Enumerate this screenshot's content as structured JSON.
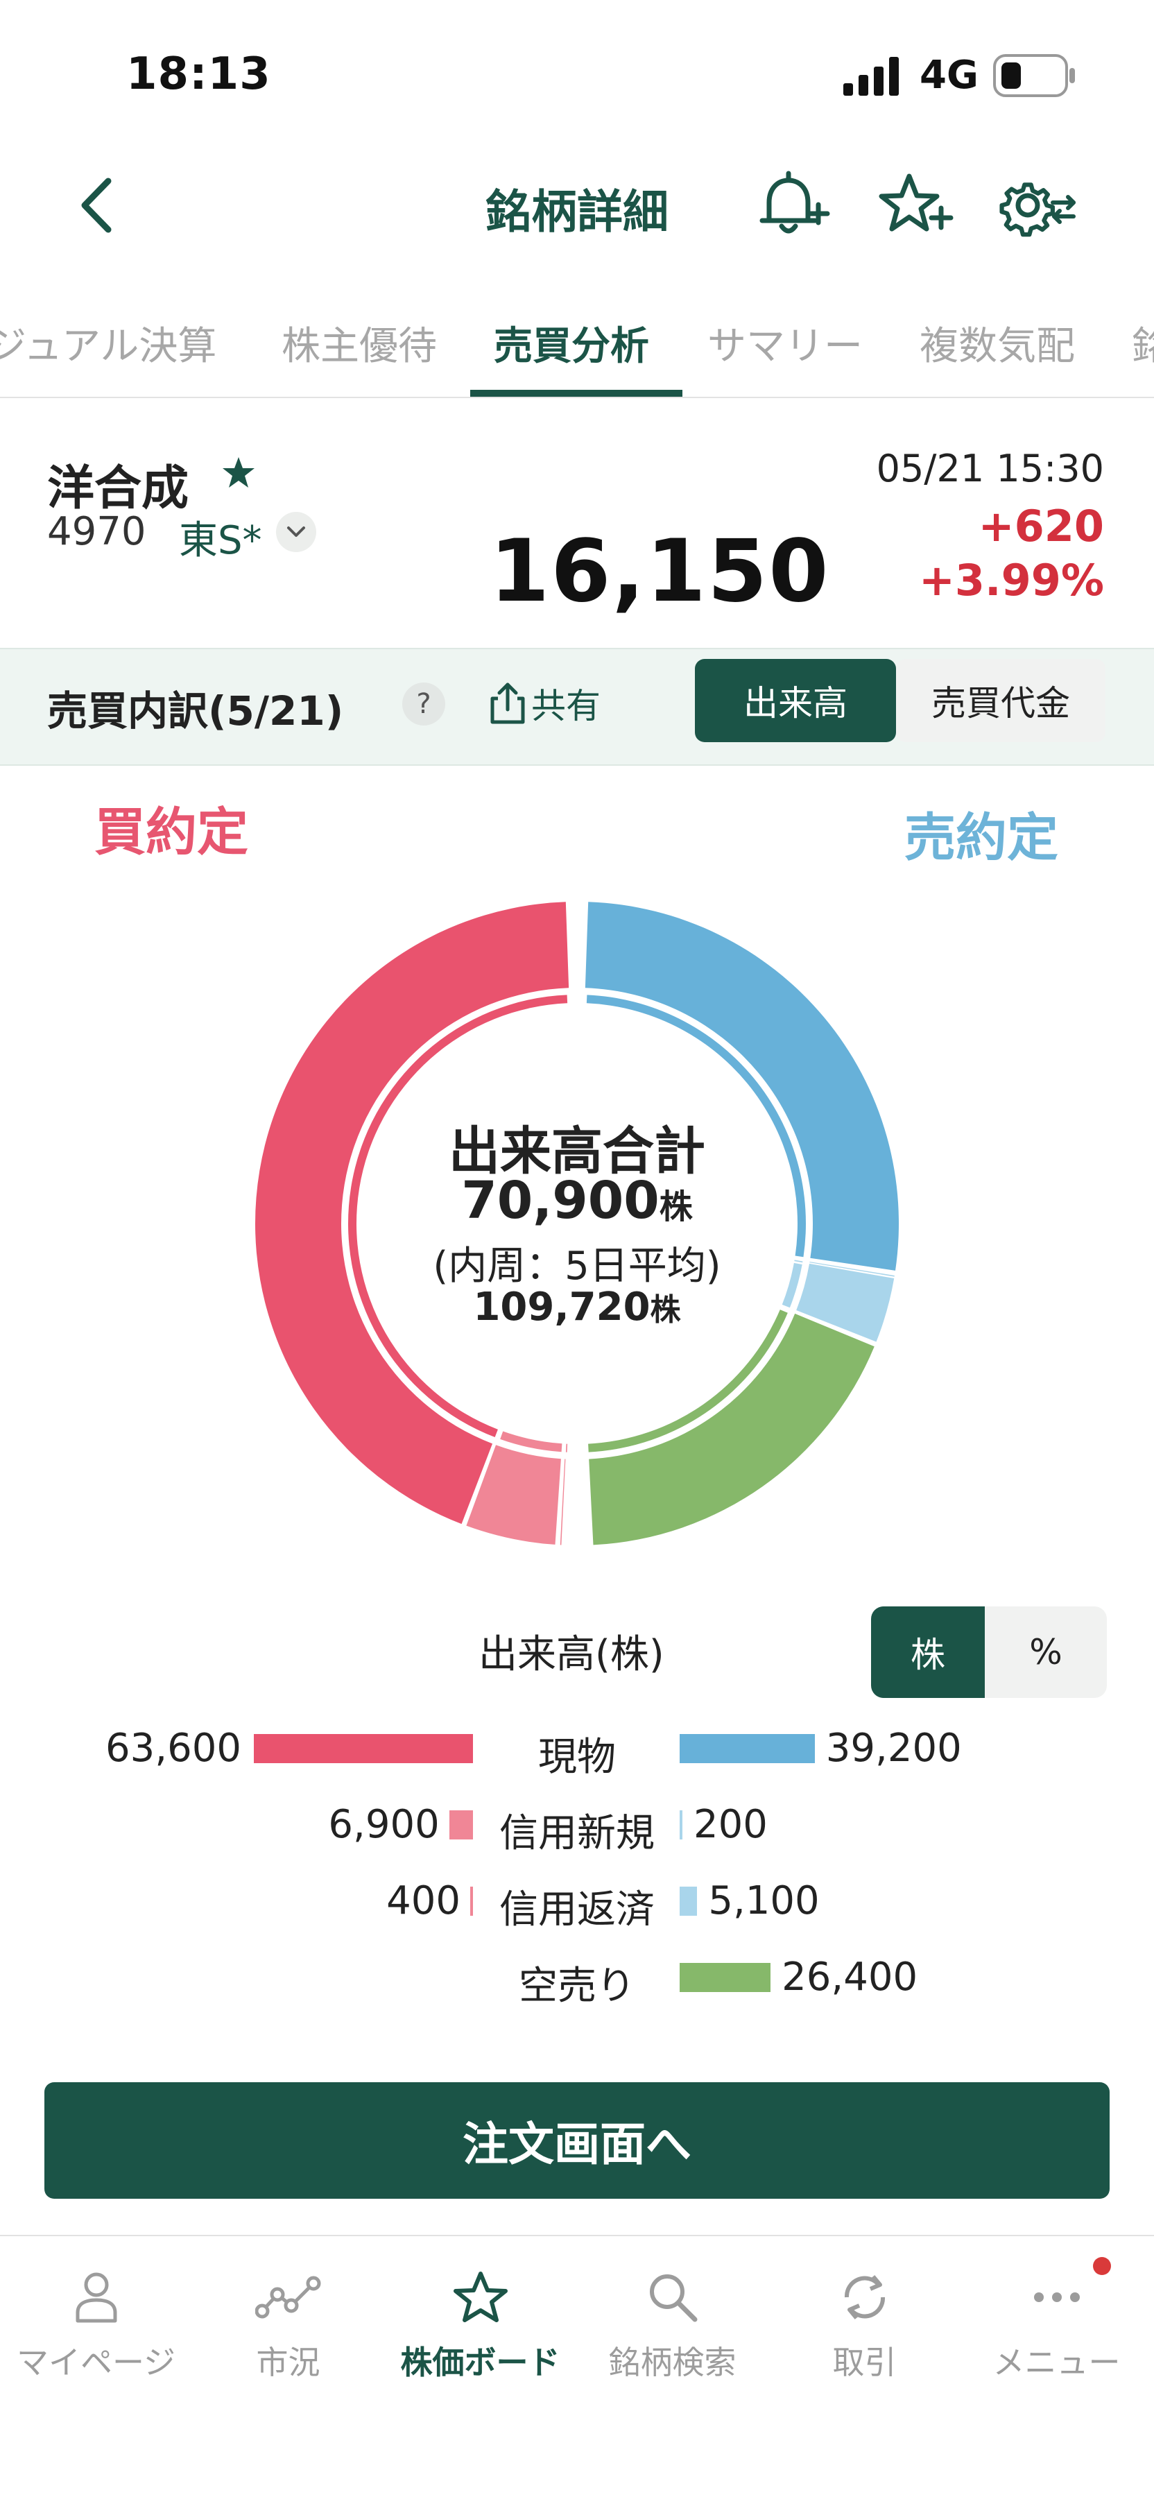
{
  "status": {
    "time": "18:13",
    "network": "4G"
  },
  "header": {
    "title": "銘柄詳細"
  },
  "tabs": [
    {
      "label": "ジュアル決算"
    },
    {
      "label": "株主優待"
    },
    {
      "label": "売買分析"
    },
    {
      "label": "サマリー"
    },
    {
      "label": "複数気配"
    },
    {
      "label": "銘"
    }
  ],
  "stock": {
    "name": "洋合成",
    "code": "4970",
    "market": "東S*",
    "price": "16,150",
    "datetime": "05/21 15:30",
    "change": "+620",
    "change_pct": "+3.99%"
  },
  "breakdown": {
    "title": "売買内訳(5/21)",
    "help": "?",
    "share": "共有",
    "toggle_volume": "出来高",
    "toggle_value": "売買代金"
  },
  "chart_labels": {
    "buy": "買約定",
    "sell": "売約定"
  },
  "center": {
    "line1": "出来高合計",
    "total": "70,900",
    "unit": "株",
    "line3": "(内周：5日平均)",
    "avg": "109,720"
  },
  "legend": {
    "title": "出来高(株)",
    "unit_share": "株",
    "unit_pct": "%",
    "rows": [
      {
        "label": "現物",
        "buy": "63,600",
        "sell": "39,200"
      },
      {
        "label": "信用新規",
        "buy": "6,900",
        "sell": "200"
      },
      {
        "label": "信用返済",
        "buy": "400",
        "sell": "5,100"
      },
      {
        "label": "空売り",
        "buy": "",
        "sell": "26,400"
      }
    ]
  },
  "order_button": "注文画面へ",
  "nav": [
    {
      "label": "マイページ",
      "icon": "person-icon"
    },
    {
      "label": "市況",
      "icon": "market-chart-icon"
    },
    {
      "label": "株価ボード",
      "icon": "star-icon"
    },
    {
      "label": "銘柄検索",
      "icon": "search-icon"
    },
    {
      "label": "取引",
      "icon": "refresh-icon"
    },
    {
      "label": "メニュー",
      "icon": "more-icon"
    }
  ],
  "colors": {
    "brand": "#1b5447",
    "buy_cash": "#e9536e",
    "buy_margin": "#f08696",
    "sell_cash": "#67b1d9",
    "sell_margin": "#a9d5eb",
    "short": "#86b86a",
    "up": "#d3303d"
  },
  "chart_data": {
    "type": "pie",
    "title": "出来高合計",
    "outer_ring": {
      "buy": [
        {
          "name": "現物",
          "value": 63600
        },
        {
          "name": "信用新規",
          "value": 6900
        },
        {
          "name": "信用返済",
          "value": 400
        }
      ],
      "sell": [
        {
          "name": "現物",
          "value": 39200
        },
        {
          "name": "信用新規",
          "value": 200
        },
        {
          "name": "信用返済",
          "value": 5100
        },
        {
          "name": "空売り",
          "value": 26400
        }
      ]
    },
    "total": 70900,
    "inner_ring_avg_total": 109720
  }
}
